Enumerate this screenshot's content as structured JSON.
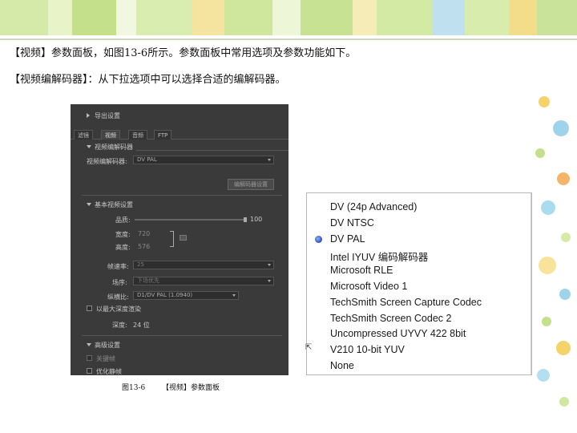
{
  "text": {
    "line1": "【视频】参数面板，如图13-6所示。参数面板中常用选项及参数功能如下。",
    "line2": "【视频编解码器】：从下拉选项中可以选择合适的编解码器。",
    "caption_num": "图13-6",
    "caption_title": "【视频】参数面板"
  },
  "panel": {
    "header": "导出设置",
    "tabs": [
      "滤镜",
      "视频",
      "音频",
      "FTP"
    ],
    "codec_section": "视频编解码器",
    "codec_label": "视频编解码器:",
    "codec_value": "DV PAL",
    "codec_button": "编解码器设置",
    "basic_section": "基本视频设置",
    "quality_label": "品质:",
    "quality_value": "100",
    "width_label": "宽度:",
    "width_value": "720",
    "height_label": "高度:",
    "height_value": "576",
    "fps_label": "帧速率:",
    "fps_value": "25",
    "field_label": "场序:",
    "field_value": "下场优先",
    "aspect_label": "纵横比:",
    "aspect_value": "D1/DV PAL (1.0940)",
    "depth_check": "以最大深度渲染",
    "depth_label": "深度:",
    "depth_value": "24 位",
    "advanced_section": "高级设置",
    "adv_check1": "关键帧",
    "adv_check2": "优化静帧"
  },
  "codec_list": {
    "items": [
      "DV (24p Advanced)",
      "DV NTSC",
      "DV PAL",
      "Intel IYUV 编码解码器",
      "Microsoft RLE",
      "Microsoft Video 1",
      "TechSmith Screen Capture Codec",
      "TechSmith Screen Codec 2",
      "Uncompressed UYVY 422 8bit",
      "V210 10-bit YUV",
      "None"
    ],
    "selected_index": 2,
    "selected_value": "DV PAL"
  },
  "colors": {
    "panel_bg": "#3a3a3a",
    "band_green": "#c4e08a",
    "band_yellow": "#f4d46a",
    "band_blue": "#9fd3ec"
  }
}
